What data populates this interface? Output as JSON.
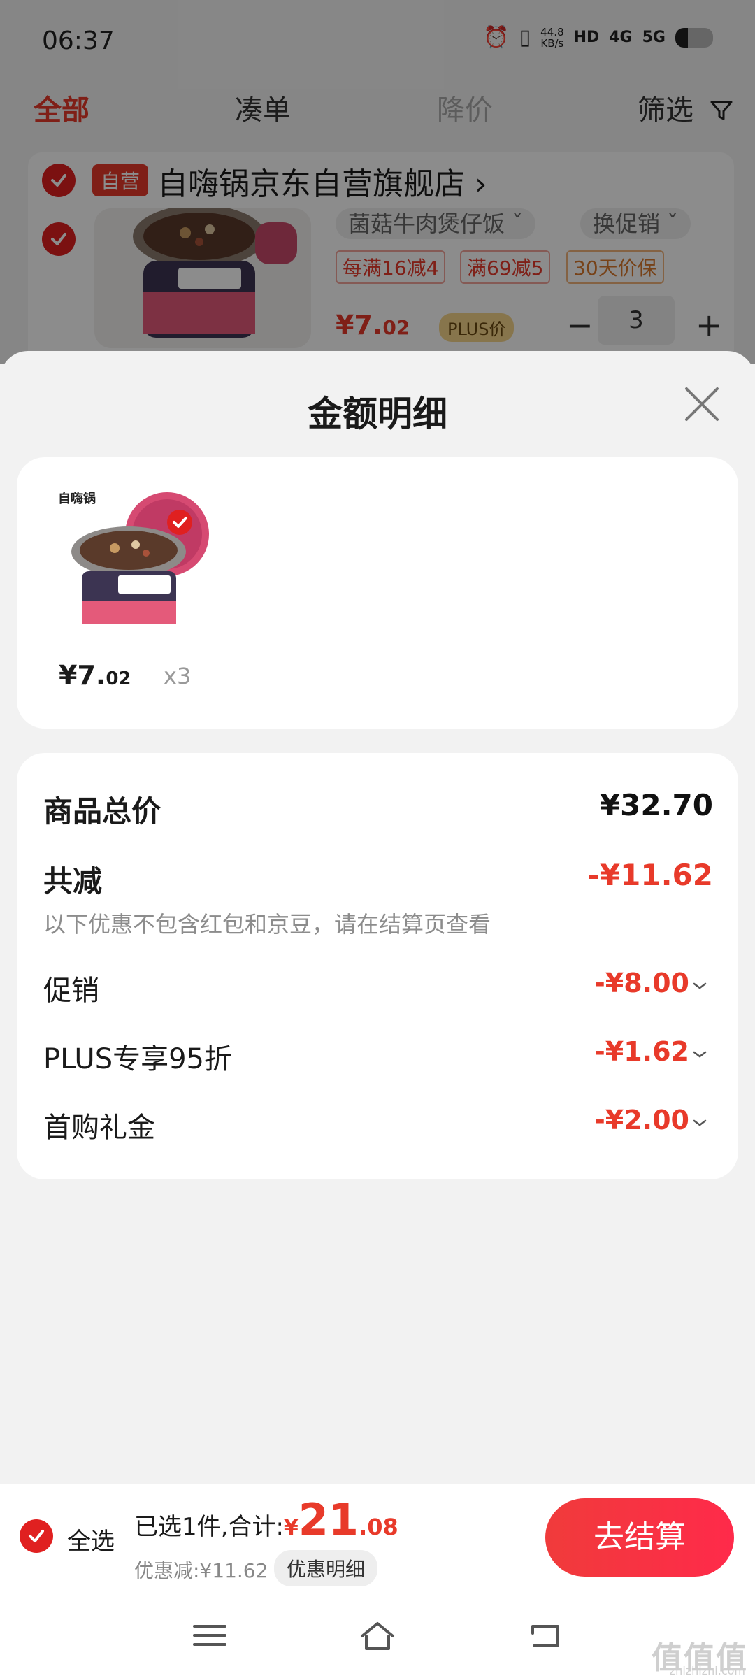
{
  "status_bar": {
    "time": "06:37",
    "net_speed": "44.8\nKB/s",
    "hd_label": "HD",
    "net_4g": "4G",
    "net_5g": "5G"
  },
  "tabs": [
    "全部",
    "凑单",
    "降价",
    "筛选"
  ],
  "store": {
    "badge": "自营",
    "name": "自嗨锅京东自营旗舰店 ›"
  },
  "product": {
    "spec": "菌菇牛肉煲仔饭 ˇ",
    "promo_switch": "换促销 ˇ",
    "promo_tags": [
      "每满16减4",
      "满69减5",
      "30天价保"
    ],
    "price_int": "¥7.",
    "price_dec": "02",
    "plus_tag": "PLUS价",
    "qty": "3",
    "minus": "−",
    "plus": "+"
  },
  "sheet": {
    "title": "金额明细",
    "goods": {
      "price_int": "¥7.",
      "price_dec": "02",
      "qty": "x3"
    },
    "total_label": "商品总价",
    "total_value": "¥32.70",
    "reduce_label": "共减",
    "reduce_value": "-¥11.62",
    "reduce_note": "以下优惠不包含红包和京豆，请在结算页查看",
    "items": [
      {
        "label": "促销",
        "value": "-¥8.00"
      },
      {
        "label": "PLUS专享95折",
        "value": "-¥1.62"
      },
      {
        "label": "首购礼金",
        "value": "-¥2.00"
      }
    ]
  },
  "bottom_bar": {
    "select_all": "全选",
    "summary_prefix": "已选1件,合计:",
    "yen": "¥",
    "total_big": "21",
    "total_dec": ".08",
    "discount": "优惠减:¥11.62",
    "detail_button": "优惠明细",
    "checkout": "去结算"
  },
  "watermark": {
    "text": "值值值",
    "sub": "zhizhizhi.com"
  },
  "colors": {
    "accent_red": "#e83a2a",
    "checkout_gradient": [
      "#f03b3b",
      "#ff2a4a"
    ]
  }
}
